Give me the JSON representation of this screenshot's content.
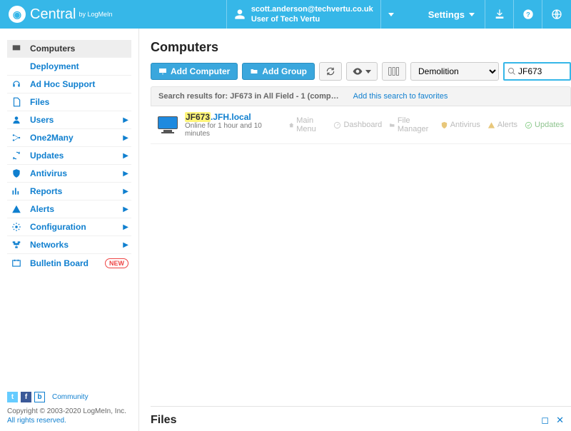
{
  "brand": {
    "name": "Central",
    "by_line": "by LogMeIn"
  },
  "user": {
    "email": "scott.anderson@techvertu.co.uk",
    "role": "User of Tech Vertu"
  },
  "topbar": {
    "settings_label": "Settings"
  },
  "sidebar": {
    "items": [
      {
        "label": "Computers",
        "active": true,
        "expandable": false,
        "icon": "monitor"
      },
      {
        "label": "Deployment",
        "active": false,
        "expandable": false,
        "icon": "download"
      },
      {
        "label": "Ad Hoc Support",
        "active": false,
        "expandable": false,
        "icon": "headset"
      },
      {
        "label": "Files",
        "active": false,
        "expandable": false,
        "icon": "file"
      },
      {
        "label": "Users",
        "active": false,
        "expandable": true,
        "icon": "user"
      },
      {
        "label": "One2Many",
        "active": false,
        "expandable": true,
        "icon": "network"
      },
      {
        "label": "Updates",
        "active": false,
        "expandable": true,
        "icon": "refresh"
      },
      {
        "label": "Antivirus",
        "active": false,
        "expandable": true,
        "icon": "shield"
      },
      {
        "label": "Reports",
        "active": false,
        "expandable": true,
        "icon": "chart"
      },
      {
        "label": "Alerts",
        "active": false,
        "expandable": true,
        "icon": "alert"
      },
      {
        "label": "Configuration",
        "active": false,
        "expandable": true,
        "icon": "gear"
      },
      {
        "label": "Networks",
        "active": false,
        "expandable": true,
        "icon": "networks"
      },
      {
        "label": "Bulletin Board",
        "active": false,
        "expandable": false,
        "icon": "board",
        "badge": "NEW"
      }
    ],
    "community_label": "Community",
    "copyright": "Copyright © 2003-2020 LogMeIn, Inc.",
    "rights": "All rights reserved."
  },
  "main": {
    "title": "Computers",
    "toolbar": {
      "add_computer": "Add Computer",
      "add_group": "Add Group",
      "group_selected": "Demolition"
    },
    "search": {
      "value": "JF673"
    },
    "results_text": "Search results for: JF673 in All Field - 1 (comp…",
    "favorite_link": "Add this search to favorites",
    "result": {
      "host_hl": "JF673",
      "host_rest": ".JFH.local",
      "status": "Online for 1 hour and 10 minutes",
      "actions": {
        "main_menu": "Main Menu",
        "dashboard": "Dashboard",
        "file_manager": "File Manager",
        "antivirus": "Antivirus",
        "alerts": "Alerts",
        "updates": "Updates"
      }
    },
    "bottom_panel_title": "Files"
  }
}
